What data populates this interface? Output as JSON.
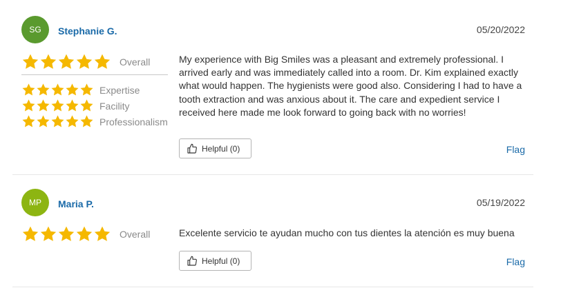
{
  "reviews": [
    {
      "initials": "SG",
      "avatar_color": "#5a9a2e",
      "name": "Stephanie G.",
      "date": "05/20/2022",
      "overall_label": "Overall",
      "overall_rating": 5,
      "sub_ratings": [
        {
          "label": "Expertise",
          "rating": 5
        },
        {
          "label": "Facility",
          "rating": 5
        },
        {
          "label": "Professionalism",
          "rating": 5
        }
      ],
      "text": "My experience with Big Smiles was a pleasant and extremely professional. I arrived early and was immediately called into a room. Dr. Kim explained exactly what would happen. The hygienists were good also. Considering I had to have a tooth extraction and was anxious about it. The care and expedient service I received here made me look forward to going back with no worries!",
      "helpful_label": "Helpful (0)",
      "flag_label": "Flag"
    },
    {
      "initials": "MP",
      "avatar_color": "#8db512",
      "name": "Maria P.",
      "date": "05/19/2022",
      "overall_label": "Overall",
      "overall_rating": 5,
      "text": "Excelente servicio te ayudan mucho con tus dientes la atención es muy buena",
      "helpful_label": "Helpful (0)",
      "flag_label": "Flag"
    }
  ],
  "colors": {
    "star": "#f5b800",
    "link": "#1a6aa8"
  },
  "icons": {
    "star": "star-icon",
    "helpful": "thumbs-up-icon"
  }
}
